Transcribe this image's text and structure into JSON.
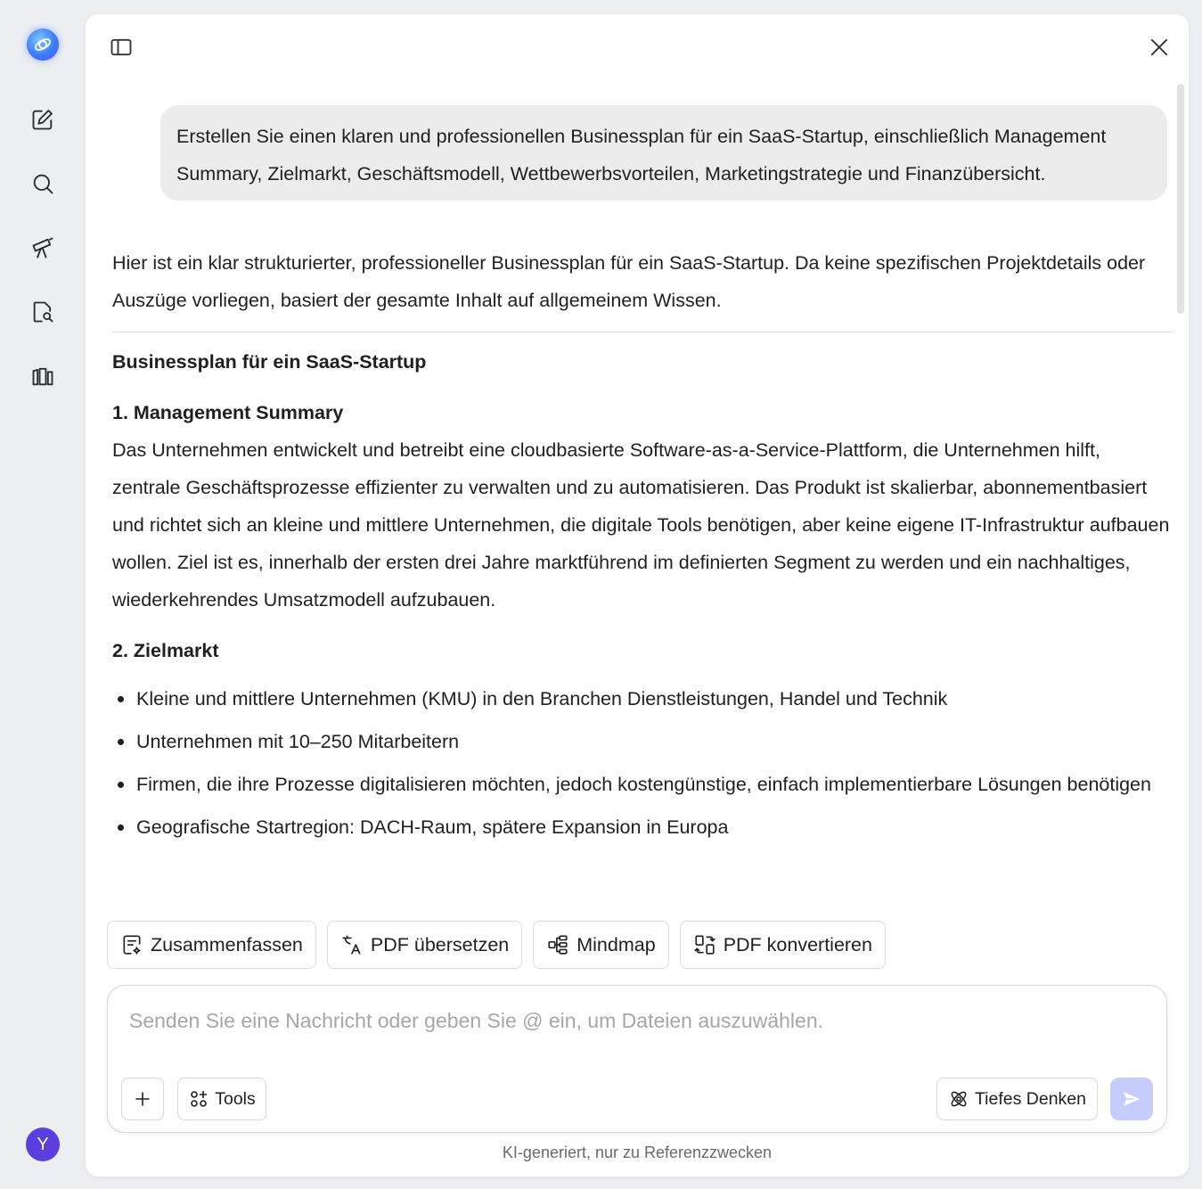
{
  "rail": {
    "items": [
      {
        "name": "logo-icon"
      },
      {
        "name": "new-chat-icon"
      },
      {
        "name": "search-icon"
      },
      {
        "name": "telescope-icon"
      },
      {
        "name": "doc-search-icon"
      },
      {
        "name": "library-icon"
      }
    ],
    "avatar_letter": "Y"
  },
  "conversation": {
    "user_message": "Erstellen Sie einen klaren und professionellen Businessplan für ein SaaS-Startup, einschließlich Management Summary, Zielmarkt, Geschäftsmodell, Wettbewerbsvorteilen, Marketingstrategie und Finanzübersicht.",
    "answer_intro": "Hier ist ein klar strukturierter, professioneller Businessplan für ein SaaS-Startup. Da keine spezifischen Projektdetails oder Auszüge vorliegen, basiert der gesamte Inhalt auf allgemeinem Wissen.",
    "answer_title": "Businessplan für ein SaaS-Startup",
    "section1_heading": "1. Management Summary",
    "section1_body": "Das Unternehmen entwickelt und betreibt eine cloudbasierte Software-as-a-Service-Plattform, die Unternehmen hilft, zentrale Geschäftsprozesse effizienter zu verwalten und zu automatisieren. Das Produkt ist skalierbar, abonnementbasiert und richtet sich an kleine und mittlere Unternehmen, die digitale Tools benötigen, aber keine eigene IT-Infrastruktur aufbauen wollen. Ziel ist es, innerhalb der ersten drei Jahre marktführend im definierten Segment zu werden und ein nachhaltiges, wiederkehrendes Umsatzmodell aufzubauen.",
    "section2_heading": "2. Zielmarkt",
    "section2_bullets": [
      "Kleine und mittlere Unternehmen (KMU) in den Branchen Dienstleistungen, Handel und Technik",
      "Unternehmen mit 10–250 Mitarbeitern",
      "Firmen, die ihre Prozesse digitalisieren möchten, jedoch kostengünstige, einfach implementierbare Lösungen benötigen",
      "Geografische Startregion: DACH-Raum, spätere Expansion in Europa"
    ]
  },
  "quick_actions": {
    "summarize": "Zusammenfassen",
    "translate_pdf": "PDF übersetzen",
    "mindmap": "Mindmap",
    "convert_pdf": "PDF konvertieren"
  },
  "composer": {
    "placeholder": "Senden Sie eine Nachricht oder geben Sie @ ein, um Dateien auszuwählen.",
    "value": "",
    "tools_label": "Tools",
    "deep_think_label": "Tiefes Denken"
  },
  "disclaimer": "KI-generiert, nur zu Referenzzwecken",
  "colors": {
    "accent": "#5b3ee0",
    "send_disabled": "#c6cdfc",
    "background": "#eceef2"
  }
}
